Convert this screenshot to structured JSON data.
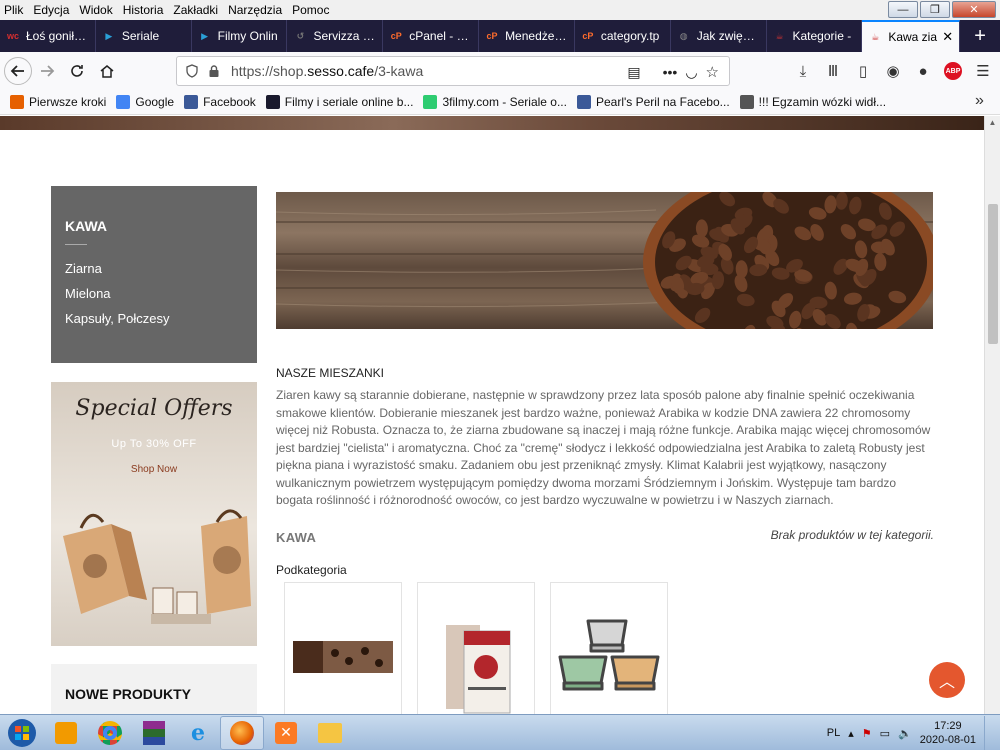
{
  "menubar": {
    "items": [
      "Plik",
      "Edycja",
      "Widok",
      "Historia",
      "Zakładki",
      "Narzędzia",
      "Pomoc"
    ]
  },
  "tabs": [
    {
      "title": "Łoś gonił sk",
      "icon": "wc",
      "color": "#d62f2f"
    },
    {
      "title": "Seriale",
      "icon": "play",
      "color": "#2a9fd6"
    },
    {
      "title": "Filmy Onlin",
      "icon": "play",
      "color": "#2a9fd6"
    },
    {
      "title": "Servizza PL",
      "icon": "loop",
      "color": "#777"
    },
    {
      "title": "cPanel - Gło",
      "icon": "cp",
      "color": "#ff6c2c"
    },
    {
      "title": "Menedżer p",
      "icon": "cp",
      "color": "#ff6c2c"
    },
    {
      "title": "category.tp",
      "icon": "cp",
      "color": "#ff6c2c"
    },
    {
      "title": "Jak zwiększ",
      "icon": "globe",
      "color": "#888"
    },
    {
      "title": "Kategorie -",
      "icon": "cup",
      "color": "#c33"
    },
    {
      "title": "Kawa zia",
      "icon": "cup",
      "color": "#c33",
      "active": true
    }
  ],
  "address": {
    "prefix": "https://shop.",
    "domain": "sesso.cafe",
    "path": "/3-kawa"
  },
  "bookmarks": [
    {
      "label": "Pierwsze kroki",
      "color": "#e66000"
    },
    {
      "label": "Google",
      "color": "#4285f4"
    },
    {
      "label": "Facebook",
      "color": "#3b5998"
    },
    {
      "label": "Filmy i seriale online b...",
      "color": "#1a1a2e"
    },
    {
      "label": "3filmy.com - Seriale o...",
      "color": "#2ecc71"
    },
    {
      "label": "Pearl's Peril na Facebo...",
      "color": "#3b5998"
    },
    {
      "label": "!!! Egzamin wózki widł...",
      "color": "#555"
    }
  ],
  "sidebar": {
    "category_title": "KAWA",
    "items": [
      "Ziarna",
      "Mielona",
      "Kapsuły, Połczesy"
    ],
    "offers": {
      "title": "Special Offers",
      "subtitle": "Up To 30% OFF",
      "button": "Shop Now"
    },
    "new_products_title": "NOWE PRODUKTY"
  },
  "main": {
    "mix_title": "NASZE MIESZANKI",
    "mix_text": "Ziaren kawy są starannie dobierane, następnie w sprawdzony przez lata sposób palone aby finalnie spełnić oczekiwania smakowe klientów. Dobieranie mieszanek jest bardzo ważne, ponieważ Arabika w kodzie DNA zawiera 22 chromosomy więcej niż Robusta. Oznacza to, że ziarna zbudowane są inaczej i mają różne funkcje. Arabika mając więcej chromosomów jest bardziej \"cielista\" i aromatyczna. Choć za \"cremę\" słodycz i lekkość odpowiedzialna jest Arabika to zaletą Robusty jest piękna piana i wyrazistość smaku. Zadaniem obu jest przeniknąć zmysły. Klimat Kalabrii jest wyjątkowy, nasączony wulkanicznym powietrzem występującym pomiędzy dwoma morzami Śródziemnym i Jońskim. Występuje tam bardzo bogata roślinność i różnorodność owoców, co jest bardzo wyczuwalne w powietrzu i w Naszych ziarnach.",
    "section_title": "KAWA",
    "no_products": "Brak produktów w tej kategorii.",
    "subcategory_label": "Podkategoria"
  },
  "taskbar": {
    "lang": "PL",
    "time": "17:29",
    "date": "2020-08-01"
  }
}
